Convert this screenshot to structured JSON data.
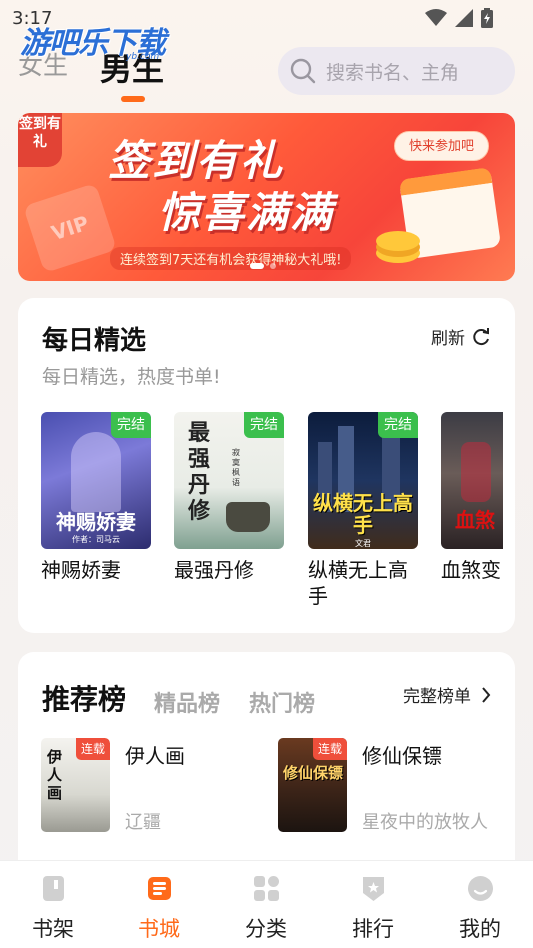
{
  "status_bar": {
    "time": "3:17"
  },
  "watermark": {
    "text": "游吧乐下载",
    "sub": "yb.com"
  },
  "gender_tabs": [
    {
      "label": "女生",
      "active": false
    },
    {
      "label": "男生",
      "active": true
    }
  ],
  "search": {
    "placeholder": "搜索书名、主角"
  },
  "banner": {
    "corner": "签到有礼",
    "title_line1": "签到有礼",
    "title_line2": "惊喜满满",
    "join_button": "快来参加吧",
    "subtitle": "连续签到7天还有机会获得神秘大礼哦!",
    "vip": "VIP"
  },
  "daily": {
    "title": "每日精选",
    "subtitle": "每日精选，热度书单!",
    "refresh": "刷新",
    "books": [
      {
        "name": "神赐娇妻",
        "cover_text": "神赐娇妻",
        "cover_author": "作者：司马云",
        "badge": "完结"
      },
      {
        "name": "最强丹修",
        "cover_text": "最强丹修",
        "cover_author": "寂寞枫语",
        "badge": "完结"
      },
      {
        "name": "纵横无上高手",
        "cover_text": "纵横无上高手",
        "cover_author": "文君",
        "badge": "完结"
      },
      {
        "name": "血煞变",
        "cover_text": "血煞",
        "cover_author": "",
        "badge": ""
      }
    ]
  },
  "rank": {
    "tabs": [
      {
        "label": "推荐榜",
        "active": true
      },
      {
        "label": "精品榜",
        "active": false
      },
      {
        "label": "热门榜",
        "active": false
      }
    ],
    "full_list": "完整榜单",
    "items": [
      {
        "name": "伊人画",
        "author": "辽疆",
        "badge": "连载",
        "cover_text": "伊人画"
      },
      {
        "name": "修仙保镖",
        "author": "星夜中的放牧人",
        "badge": "连载",
        "cover_text": "修仙保镖"
      }
    ]
  },
  "bottom_nav": [
    {
      "label": "书架",
      "active": false,
      "icon": "bookshelf-icon"
    },
    {
      "label": "书城",
      "active": true,
      "icon": "bookstore-icon"
    },
    {
      "label": "分类",
      "active": false,
      "icon": "category-icon"
    },
    {
      "label": "排行",
      "active": false,
      "icon": "ranking-icon"
    },
    {
      "label": "我的",
      "active": false,
      "icon": "profile-icon"
    }
  ],
  "colors": {
    "accent": "#ff6a1a",
    "badge_green": "#3bbf4d",
    "badge_red": "#ef4f3b"
  }
}
